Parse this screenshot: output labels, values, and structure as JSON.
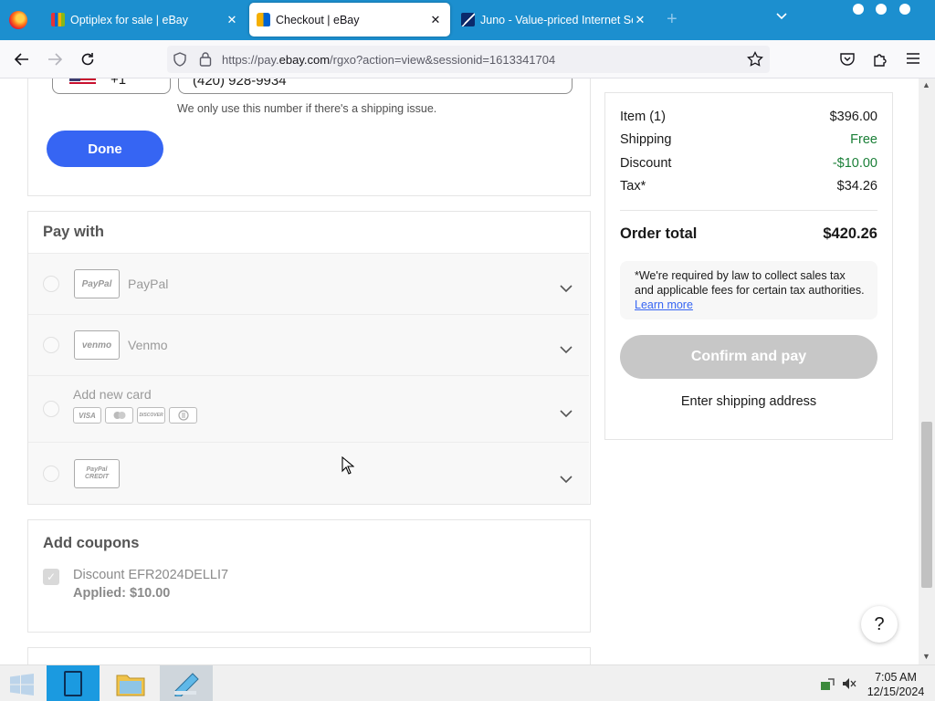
{
  "browser": {
    "tabs": [
      {
        "title": "Optiplex for sale | eBay",
        "active": false
      },
      {
        "title": "Checkout | eBay",
        "active": true
      },
      {
        "title": "Juno - Value-priced Internet Ser",
        "active": false
      }
    ],
    "url_prefix": "https://pay.",
    "url_domain": "ebay.com",
    "url_rest": "/rgxo?action=view&sessionid=1613341704",
    "new_tab_symbol": "+",
    "close_symbol": "✕"
  },
  "phone": {
    "country_code": "+1",
    "number": "(420) 928-9934",
    "help": "We only use this number if there's a shipping issue.",
    "done_label": "Done"
  },
  "pay_with": {
    "title": "Pay with",
    "methods": [
      {
        "logo": "PayPal",
        "label": "PayPal"
      },
      {
        "logo": "venmo",
        "label": "Venmo"
      },
      {
        "logo": "",
        "label": "Add new card"
      },
      {
        "logo": "PayPal CREDIT",
        "label": ""
      }
    ],
    "card_brands": [
      "VISA",
      "",
      "DISCOVER",
      ""
    ]
  },
  "coupons": {
    "title": "Add coupons",
    "label": "Discount EFR2024DELLI7",
    "applied": "Applied: $10.00"
  },
  "summary": {
    "rows": [
      {
        "label": "Item (1)",
        "value": "$396.00"
      },
      {
        "label": "Shipping",
        "value": "Free"
      },
      {
        "label": "Discount",
        "value": "-$10.00"
      },
      {
        "label": "Tax*",
        "value": "$34.26"
      }
    ],
    "total_label": "Order total",
    "total_value": "$420.26",
    "tax_note": "*We're required by law to collect sales tax and applicable fees for certain tax authorities.",
    "learn_more": "Learn more",
    "confirm_label": "Confirm and pay",
    "shipping_link": "Enter shipping address"
  },
  "help_label": "?",
  "taskbar": {
    "time": "7:05 AM",
    "date": "12/15/2024"
  },
  "colors": {
    "ebay_blue": "#3665f3",
    "firefox_tabbar": "#1c8fcf",
    "green": "#1a7f37"
  }
}
